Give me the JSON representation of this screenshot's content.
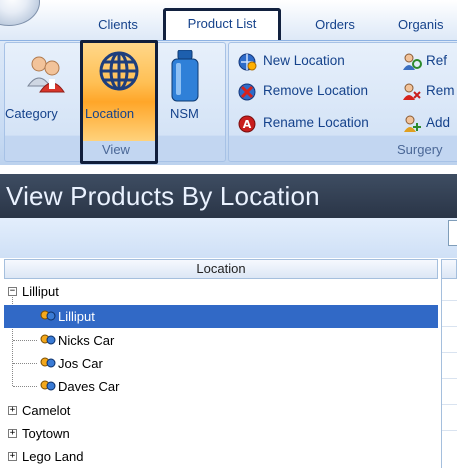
{
  "tabs": {
    "clients": "Clients",
    "product_list": "Product List",
    "orders": "Orders",
    "organisation": "Organis"
  },
  "ribbon": {
    "view_group": {
      "label": "View",
      "buttons": {
        "category": "Category",
        "location": "Location",
        "nsm": "NSM"
      }
    },
    "surgery_group": {
      "label": "Surgery",
      "buttons": {
        "new_location": "New Location",
        "remove_location": "Remove Location",
        "rename_location": "Rename Location",
        "ref": "Ref",
        "rem": "Rem",
        "add": "Add"
      }
    }
  },
  "title": "View Products By Location",
  "grid": {
    "column_header": "Location",
    "rows": [
      {
        "label": "Lilliput",
        "expander": "−"
      },
      {
        "label": "Lilliput"
      },
      {
        "label": "Nicks Car"
      },
      {
        "label": "Jos Car"
      },
      {
        "label": "Daves Car"
      },
      {
        "label": "Camelot",
        "expander": "+"
      },
      {
        "label": "Toytown",
        "expander": "+"
      },
      {
        "label": "Lego Land",
        "expander": "+"
      }
    ]
  },
  "colors": {
    "selection": "#3169c6",
    "title_bar": "#2f3b4e",
    "ribbon_accent": "#ffb23a"
  }
}
